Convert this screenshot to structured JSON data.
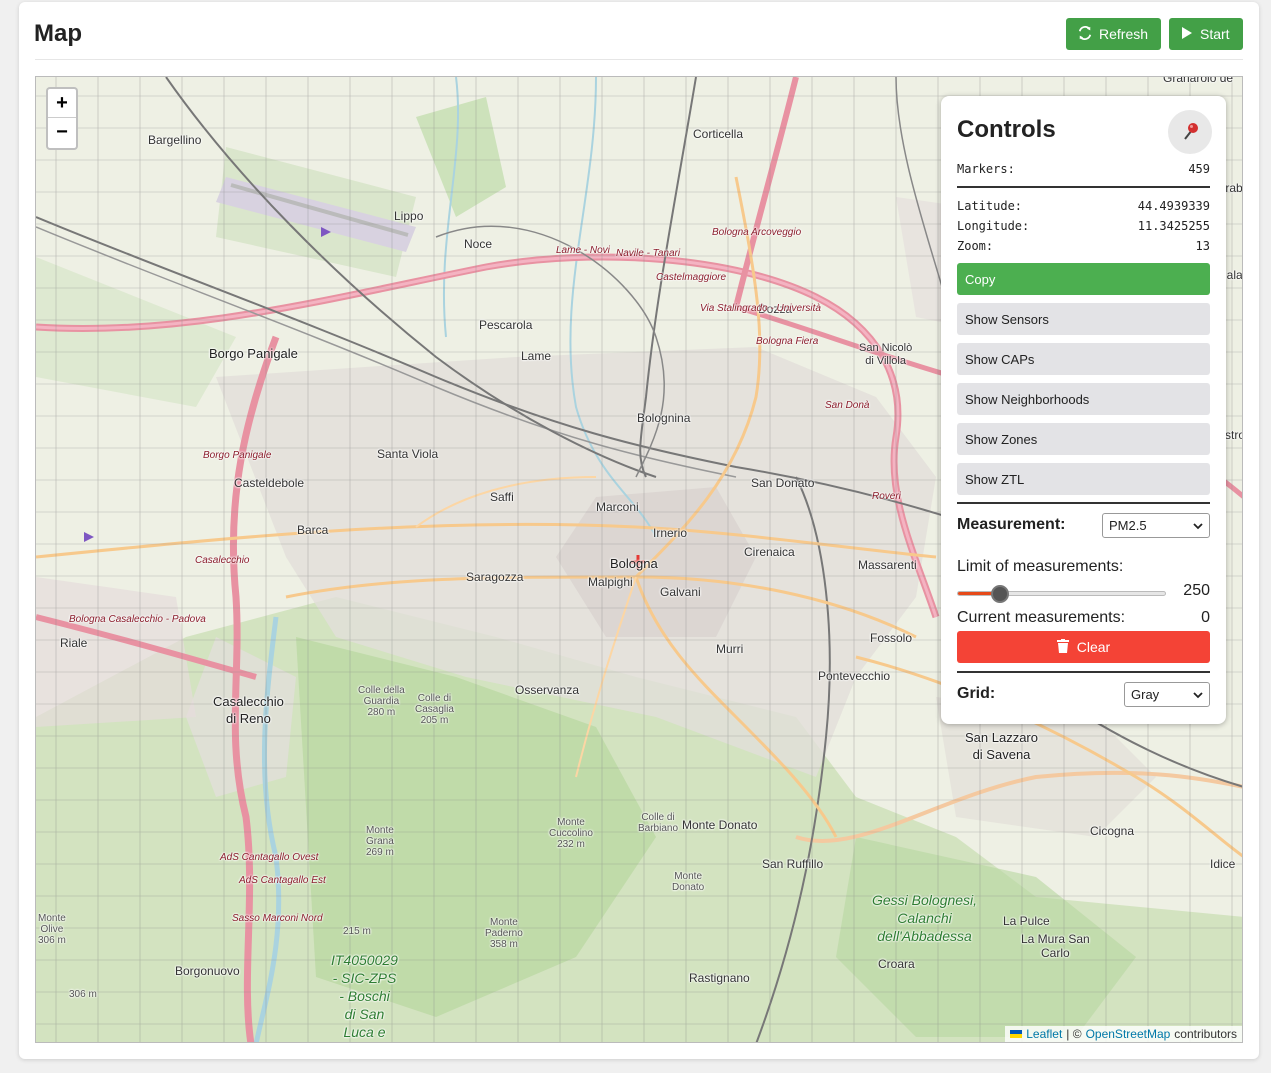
{
  "page": {
    "title": "Map",
    "refresh_label": "Refresh",
    "start_label": "Start"
  },
  "map": {
    "zoom_in": "+",
    "zoom_out": "−",
    "attribution": {
      "leaflet": "Leaflet",
      "separator": "| ©",
      "osm": "OpenStreetMap",
      "suffix": "contributors"
    },
    "places": [
      {
        "text": "Bargellino",
        "cls": ""
      },
      {
        "text": "Corticella",
        "cls": ""
      },
      {
        "text": "Lippo",
        "cls": ""
      },
      {
        "text": "Noce",
        "cls": ""
      },
      {
        "text": "Pescarola",
        "cls": ""
      },
      {
        "text": "Lame",
        "cls": ""
      },
      {
        "text": "Borgo Panigale",
        "cls": "big"
      },
      {
        "text": "Dozza",
        "cls": ""
      },
      {
        "text": "Bolognina",
        "cls": ""
      },
      {
        "text": "Santa Viola",
        "cls": ""
      },
      {
        "text": "Casteldebole",
        "cls": ""
      },
      {
        "text": "Saffi",
        "cls": ""
      },
      {
        "text": "Marconi",
        "cls": ""
      },
      {
        "text": "Irnerio",
        "cls": ""
      },
      {
        "text": "San Donato",
        "cls": ""
      },
      {
        "text": "Barca",
        "cls": ""
      },
      {
        "text": "Bologna",
        "cls": "big"
      },
      {
        "text": "Cirenaica",
        "cls": ""
      },
      {
        "text": "Saragozza",
        "cls": ""
      },
      {
        "text": "Malpighi",
        "cls": ""
      },
      {
        "text": "Galvani",
        "cls": ""
      },
      {
        "text": "Massarenti",
        "cls": ""
      },
      {
        "text": "Riale",
        "cls": ""
      },
      {
        "text": "Murri",
        "cls": ""
      },
      {
        "text": "Fossolo",
        "cls": ""
      },
      {
        "text": "Osservanza",
        "cls": ""
      },
      {
        "text": "Pontevecchio",
        "cls": ""
      },
      {
        "text": "Casalecchio\ndi Reno",
        "cls": "big"
      },
      {
        "text": "San Lazzaro\ndi Savena",
        "cls": "big"
      },
      {
        "text": "Cicogna",
        "cls": ""
      },
      {
        "text": "Monte Donato",
        "cls": ""
      },
      {
        "text": "San Ruffillo",
        "cls": ""
      },
      {
        "text": "Idice",
        "cls": ""
      },
      {
        "text": "Borgonuovo",
        "cls": ""
      },
      {
        "text": "Rastignano",
        "cls": ""
      },
      {
        "text": "Croara",
        "cls": ""
      },
      {
        "text": "La Pulce",
        "cls": ""
      },
      {
        "text": "La Mura San\nCarlo",
        "cls": ""
      },
      {
        "text": "San Nicolò\ndi Villola",
        "cls": ""
      },
      {
        "text": "Pilastro",
        "cls": ""
      },
      {
        "text": "Granarolo de",
        "cls": ""
      },
      {
        "text": "Frab",
        "cls": ""
      },
      {
        "text": "Cala",
        "cls": ""
      },
      {
        "text": "Borgo Panigale",
        "cls": "rail"
      },
      {
        "text": "Bologna Arcoveggio",
        "cls": "rail"
      },
      {
        "text": "Lame - Novi",
        "cls": "rail"
      },
      {
        "text": "Navile - Tanari",
        "cls": "rail"
      },
      {
        "text": "Castelmaggiore",
        "cls": "rail"
      },
      {
        "text": "Via Stalingrado - Università",
        "cls": "rail"
      },
      {
        "text": "Bologna Fiera",
        "cls": "rail"
      },
      {
        "text": "San Donà",
        "cls": "rail"
      },
      {
        "text": "Casalecchio",
        "cls": "rail"
      },
      {
        "text": "Bologna Casalecchio - Padova",
        "cls": "rail"
      },
      {
        "text": "AdS Cantagallo Ovest",
        "cls": "rail"
      },
      {
        "text": "AdS Cantagallo Est",
        "cls": "rail"
      },
      {
        "text": "Sasso Marconi Nord",
        "cls": "rail"
      },
      {
        "text": "Roveri",
        "cls": "rail"
      },
      {
        "text": "Gessi Bolognesi,\nCalanchi\ndell'Abbadessa",
        "cls": "nature"
      },
      {
        "text": "IT4050029\n- SIC-ZPS\n- Boschi\ndi San\nLuca e",
        "cls": "nature"
      },
      {
        "text": "Colle della\nGuardia\n280 m",
        "cls": "small"
      },
      {
        "text": "Colle di\nCasaglia\n205 m",
        "cls": "small"
      },
      {
        "text": "Monte\nGrana\n269 m",
        "cls": "small"
      },
      {
        "text": "Monte\nCuccolino\n232 m",
        "cls": "small"
      },
      {
        "text": "Colle di\nBarbiano",
        "cls": "small"
      },
      {
        "text": "Monte\nDonato",
        "cls": "small"
      },
      {
        "text": "Monte\nPaderno\n358 m",
        "cls": "small"
      },
      {
        "text": "Monte\nOlive\n306 m",
        "cls": "small"
      },
      {
        "text": "215 m",
        "cls": "small"
      },
      {
        "text": "306 m",
        "cls": "small"
      }
    ]
  },
  "controls": {
    "title": "Controls",
    "pin_icon": "map-pin-icon",
    "markers_label": "Markers:",
    "markers_value": "459",
    "latitude_label": "Latitude:",
    "latitude_value": "44.4939339",
    "longitude_label": "Longitude:",
    "longitude_value": "11.3425255",
    "zoom_label": "Zoom:",
    "zoom_value": "13",
    "copy_label": "Copy",
    "buttons": [
      "Show Sensors",
      "Show CAPs",
      "Show Neighborhoods",
      "Show Zones",
      "Show ZTL"
    ],
    "measurement_label": "Measurement:",
    "measurement_value": "PM2.5",
    "limit_label": "Limit of measurements:",
    "limit_value": "250",
    "limit_fraction": 0.2,
    "current_label": "Current measurements:",
    "current_value": "0",
    "clear_label": "Clear",
    "grid_label": "Grid:",
    "grid_value": "Gray"
  },
  "colors": {
    "green_button": "#43a047",
    "copy_button": "#4caf50",
    "clear_button": "#f44336",
    "slider_fill": "#e64a19"
  }
}
